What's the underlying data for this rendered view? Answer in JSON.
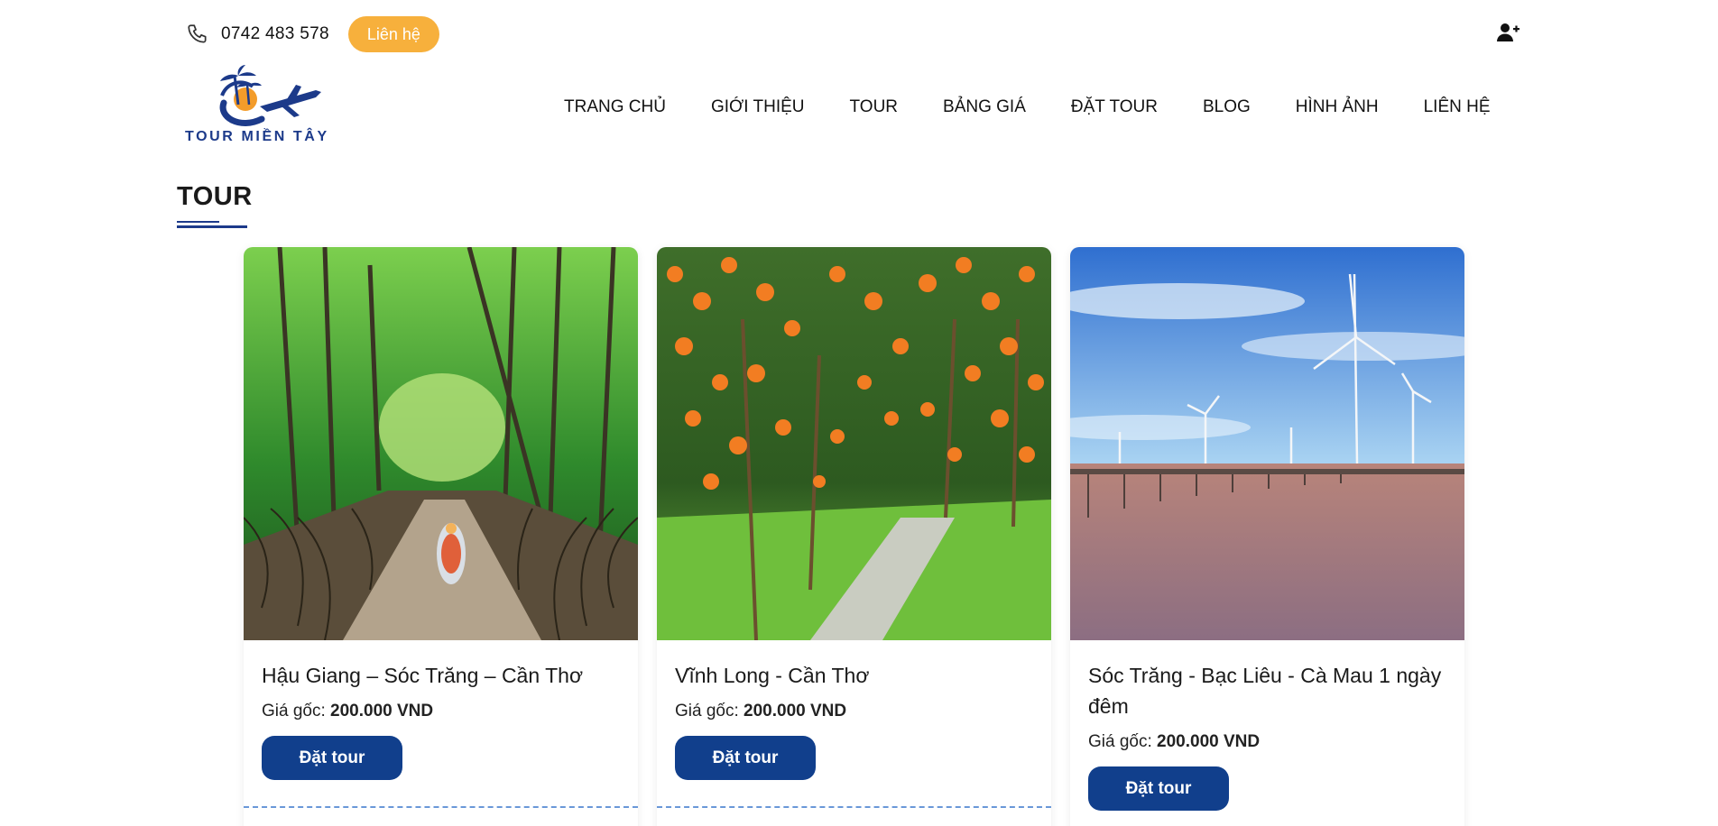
{
  "header": {
    "phone": "0742 483 578",
    "contact_button": "Liên hệ",
    "phone_icon": "phone-icon",
    "user_icon": "user-plus-icon"
  },
  "logo": {
    "text": "TOUR MIỀN TÂY",
    "colors": {
      "navy": "#1c3a8a",
      "orange": "#f39c2a"
    }
  },
  "nav": {
    "items": [
      "TRANG CHỦ",
      "GIỚI THIỆU",
      "TOUR",
      "BẢNG GIÁ",
      "ĐẶT TOUR",
      "BLOG",
      "HÌNH ẢNH",
      "LIÊN HỆ"
    ]
  },
  "section": {
    "title": "TOUR"
  },
  "tours": [
    {
      "name": "Hậu Giang – Sóc Trăng – Cần Thơ",
      "price_label": "Giá gốc:",
      "price": "200.000 VND",
      "button": "Đặt tour",
      "image": "mangrove-river-boat"
    },
    {
      "name": "Vĩnh Long - Cần Thơ",
      "price_label": "Giá gốc:",
      "price": "200.000 VND",
      "button": "Đặt tour",
      "image": "orange-orchard-path"
    },
    {
      "name": "Sóc Trăng - Bạc Liêu - Cà Mau 1 ngày đêm",
      "price_label": "Giá gốc:",
      "price": "200.000 VND",
      "button": "Đặt tour",
      "image": "wind-turbines-sea"
    }
  ],
  "colors": {
    "accent_orange": "#f7b03c",
    "primary_blue": "#113f8c",
    "divider_blue": "#6a98d8"
  }
}
